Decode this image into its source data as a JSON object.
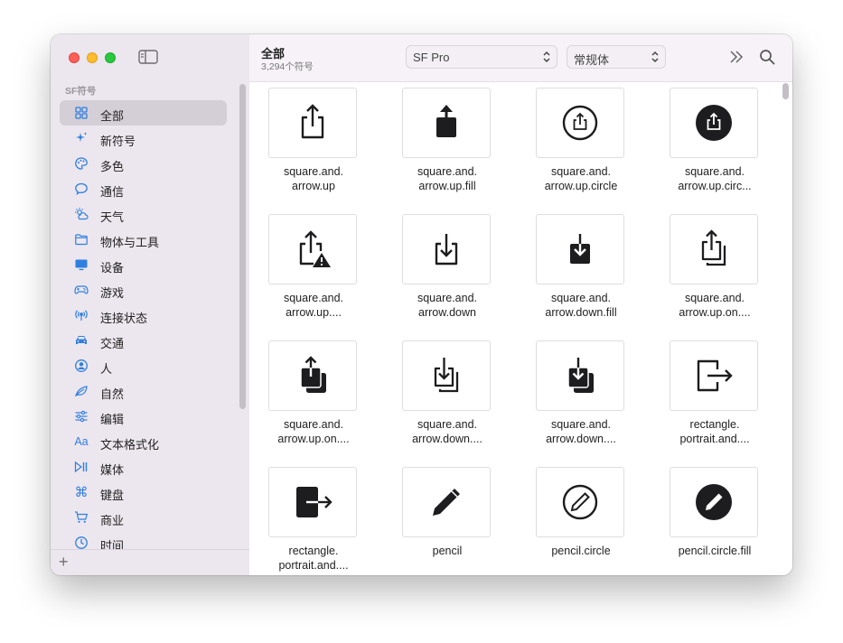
{
  "sidebar": {
    "section_title": "SF符号",
    "items": [
      {
        "label": "全部",
        "icon": "grid-icon",
        "selected": true
      },
      {
        "label": "新符号",
        "icon": "sparkles-icon"
      },
      {
        "label": "多色",
        "icon": "palette-icon"
      },
      {
        "label": "通信",
        "icon": "message-bubble-icon"
      },
      {
        "label": "天气",
        "icon": "cloud-sun-icon"
      },
      {
        "label": "物体与工具",
        "icon": "folder-icon"
      },
      {
        "label": "设备",
        "icon": "display-icon"
      },
      {
        "label": "游戏",
        "icon": "gamecontroller-icon"
      },
      {
        "label": "连接状态",
        "icon": "antenna-icon"
      },
      {
        "label": "交通",
        "icon": "car-icon"
      },
      {
        "label": "人",
        "icon": "person-circle-icon"
      },
      {
        "label": "自然",
        "icon": "leaf-icon"
      },
      {
        "label": "编辑",
        "icon": "sliders-icon"
      },
      {
        "label": "文本格式化",
        "icon": "textformat-icon"
      },
      {
        "label": "媒体",
        "icon": "play-pause-icon"
      },
      {
        "label": "键盘",
        "icon": "command-icon"
      },
      {
        "label": "商业",
        "icon": "cart-icon"
      },
      {
        "label": "时间",
        "icon": "clock-icon"
      }
    ],
    "add_label": "+"
  },
  "toolbar": {
    "title": "全部",
    "subtitle": "3,294个符号",
    "font_select": "SF Pro",
    "weight_select": "常规体"
  },
  "symbols": [
    {
      "line1": "square.and.",
      "line2": "arrow.up",
      "icon": "square-and-arrow-up-icon"
    },
    {
      "line1": "square.and.",
      "line2": "arrow.up.fill",
      "icon": "square-and-arrow-up-fill-icon"
    },
    {
      "line1": "square.and.",
      "line2": "arrow.up.circle",
      "icon": "square-and-arrow-up-circle-icon"
    },
    {
      "line1": "square.and.",
      "line2": "arrow.up.circ...",
      "icon": "square-and-arrow-up-circle-fill-icon"
    },
    {
      "line1": "square.and.",
      "line2": "arrow.up....",
      "icon": "square-and-arrow-up-trianglebadge-icon"
    },
    {
      "line1": "square.and.",
      "line2": "arrow.down",
      "icon": "square-and-arrow-down-icon"
    },
    {
      "line1": "square.and.",
      "line2": "arrow.down.fill",
      "icon": "square-and-arrow-down-fill-icon"
    },
    {
      "line1": "square.and.",
      "line2": "arrow.up.on....",
      "icon": "square-and-arrow-up-on-square-icon"
    },
    {
      "line1": "square.and.",
      "line2": "arrow.up.on....",
      "icon": "square-and-arrow-up-on-square-fill-icon"
    },
    {
      "line1": "square.and.",
      "line2": "arrow.down....",
      "icon": "square-and-arrow-down-on-square-icon"
    },
    {
      "line1": "square.and.",
      "line2": "arrow.down....",
      "icon": "square-and-arrow-down-on-square-fill-icon"
    },
    {
      "line1": "rectangle.",
      "line2": "portrait.and....",
      "icon": "rectangle-portrait-and-arrow-right-icon"
    },
    {
      "line1": "rectangle.",
      "line2": "portrait.and....",
      "icon": "rectangle-portrait-and-arrow-right-fill-icon"
    },
    {
      "line1": "pencil",
      "line2": "",
      "icon": "pencil-icon"
    },
    {
      "line1": "pencil.circle",
      "line2": "",
      "icon": "pencil-circle-icon"
    },
    {
      "line1": "pencil.circle.fill",
      "line2": "",
      "icon": "pencil-circle-fill-icon"
    }
  ],
  "colors": {
    "accent": "#2f7fe0",
    "glyph": "#1d1d1f"
  }
}
